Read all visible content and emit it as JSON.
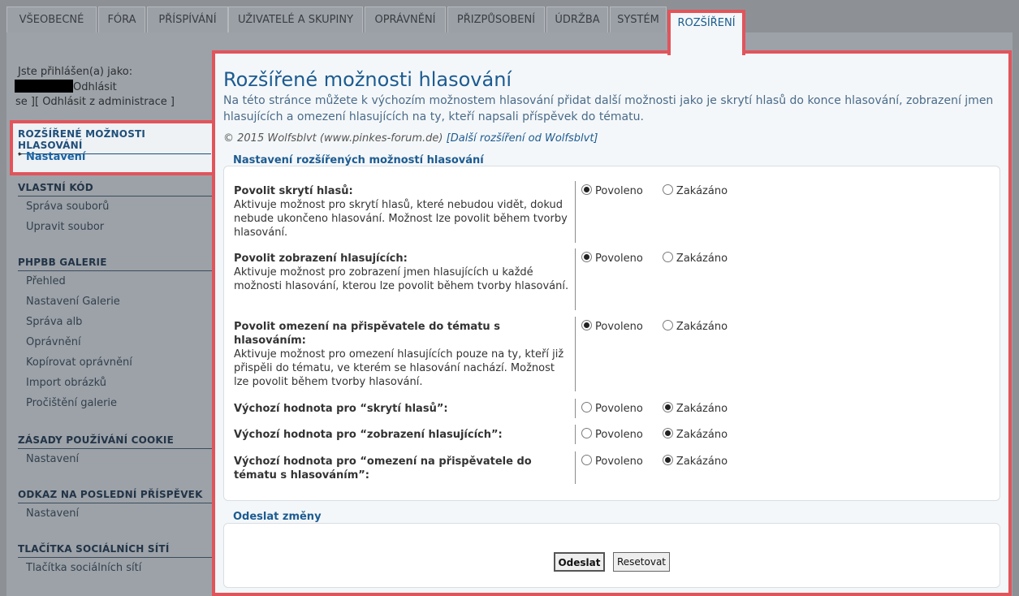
{
  "tabs": [
    "Všeobecné",
    "Fóra",
    "Příspívání",
    "Uživatelé a skupiny",
    "Oprávnění",
    "Přizpůsobení",
    "Údržba",
    "Systém",
    "Rozšíření"
  ],
  "sidebar": {
    "login_prefix": "Jste přihlášen(a) jako:",
    "logout": "Odhlásit",
    "logout_admin_prefix": "se ][",
    "logout_admin": "Odhlásit z administrace",
    "logout_admin_suffix": "]",
    "active_group": {
      "title": "Rozšířené možnosti hlasování",
      "item": "Nastavení"
    },
    "groups": [
      {
        "title": "Vlastní kód",
        "items": [
          "Správa souborů",
          "Upravit soubor"
        ]
      },
      {
        "title": "phpBB Galerie",
        "items": [
          "Přehled",
          "Nastavení Galerie",
          "Správa alb",
          "Oprávnění",
          "Kopírovat oprávnění",
          "Import obrázků",
          "Pročištění galerie"
        ]
      },
      {
        "title": "Zásady používání cookie",
        "items": [
          "Nastavení"
        ]
      },
      {
        "title": "Odkaz na poslední příspěvek",
        "items": [
          "Nastavení"
        ]
      },
      {
        "title": "Tlačítka sociálních sítí",
        "items": [
          "Tlačítka sociálních sítí"
        ]
      }
    ]
  },
  "main": {
    "title": "Rozšířené možnosti hlasování",
    "description": "Na této stránce můžete k výchozím možnostem hlasování přidat další možnosti jako je skrytí hlasů do konce hlasování, zobrazení jmen hlasujících a omezení hlasujících na ty, kteří napsali příspěvek do tématu.",
    "copyright_text": "© 2015 Wolfsblvt (www.pinkes-forum.de)",
    "copyright_link": "[Další rozšíření od Wolfsblvt]",
    "settings_legend": "Nastavení rozšířených možností hlasování",
    "enabled_label": "Povoleno",
    "disabled_label": "Zakázáno",
    "settings": [
      {
        "title": "Povolit skrytí hlasů:",
        "explain": "Aktivuje možnost pro skrytí hlasů, které nebudou vidět, dokud nebude ukončeno hlasování. Možnost lze povolit během tvorby hlasování.",
        "value": "enabled"
      },
      {
        "title": "Povolit zobrazení hlasujících:",
        "explain": "Aktivuje možnost pro zobrazení jmen hlasujících u každé možnosti hlasování, kterou lze povolit během tvorby hlasování.",
        "value": "enabled"
      },
      {
        "title": "Povolit omezení na přispěvatele do tématu s hlasováním:",
        "explain": "Aktivuje možnost pro omezení hlasujících pouze na ty, kteří již přispěli do tématu, ve kterém se hlasování nachází. Možnost lze povolit během tvorby hlasování.",
        "value": "enabled"
      },
      {
        "title": "Výchozí hodnota pro “skrytí hlasů”:",
        "explain": "",
        "value": "disabled"
      },
      {
        "title": "Výchozí hodnota pro “zobrazení hlasujících”:",
        "explain": "",
        "value": "disabled"
      },
      {
        "title": "Výchozí hodnota pro “omezení na přispěvatele do tématu s hlasováním”:",
        "explain": "",
        "value": "disabled"
      }
    ],
    "submit_legend": "Odeslat změny",
    "submit_button": "Odeslat",
    "reset_button": "Resetovat"
  },
  "colors": {
    "highlight_border": "#e2545b",
    "link_blue": "#1c5b91"
  }
}
